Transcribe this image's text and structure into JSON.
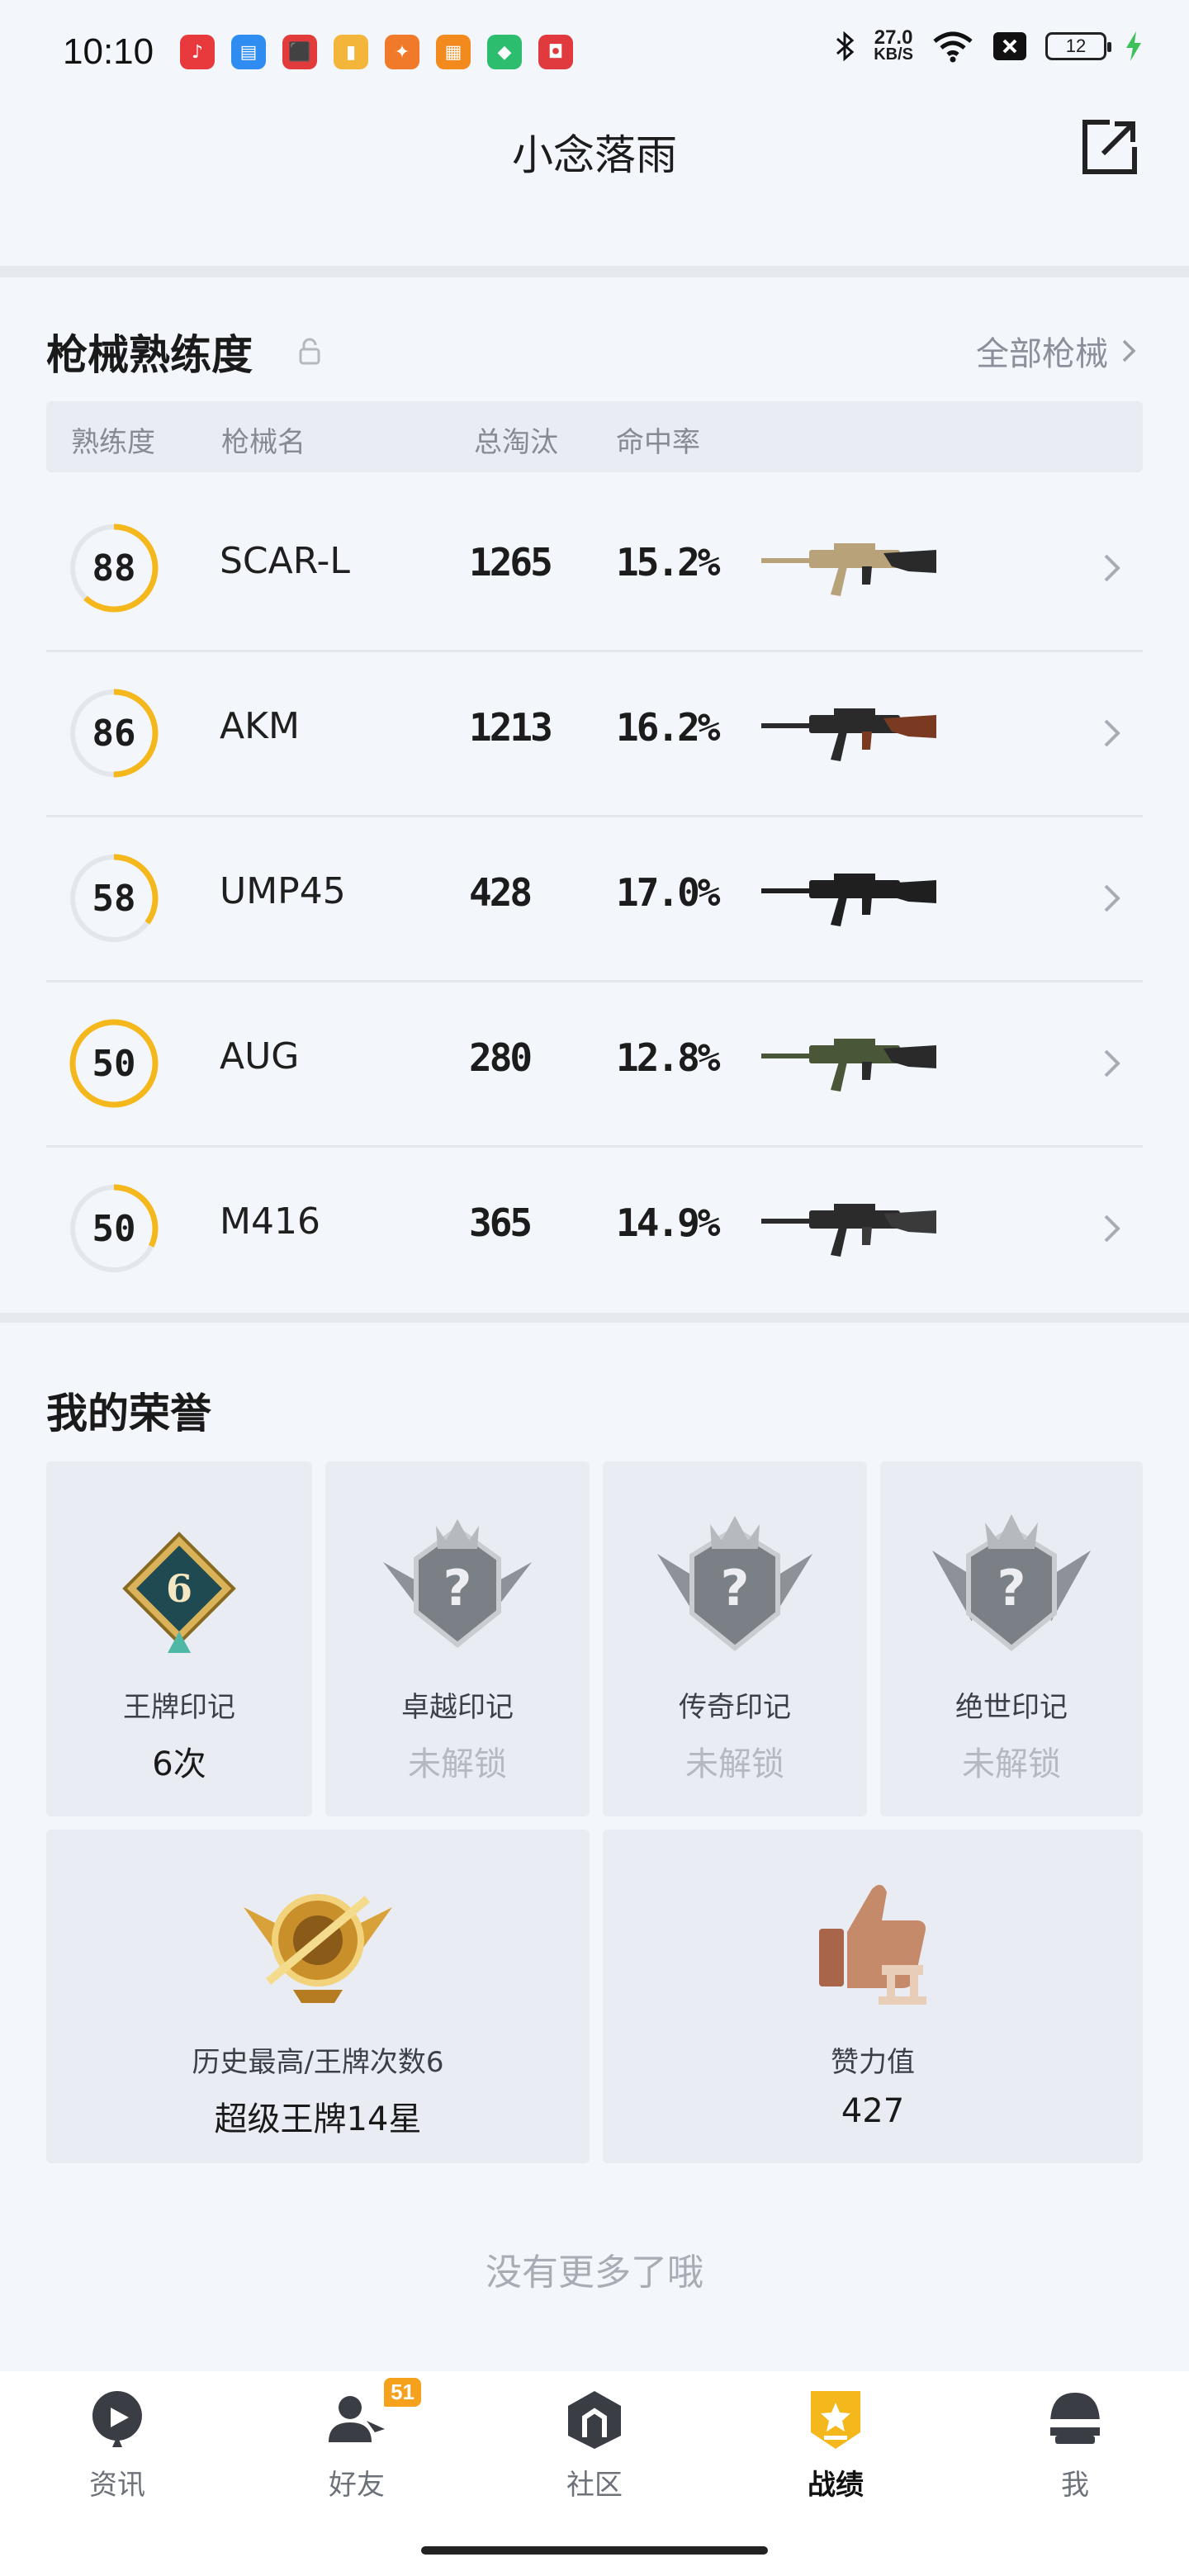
{
  "status_bar": {
    "time": "10:10",
    "net_speed_value": "27.0",
    "net_speed_unit": "KB/S",
    "battery": "12",
    "apps": [
      {
        "icon": "music-app-icon",
        "color": "#e8393d",
        "glyph": "♪"
      },
      {
        "icon": "files-app-icon",
        "color": "#2f8cf0",
        "glyph": "▤"
      },
      {
        "icon": "shop-app-icon",
        "color": "#e23b3b",
        "glyph": "⬛"
      },
      {
        "icon": "notes-app-icon",
        "color": "#f3b53a",
        "glyph": "▮"
      },
      {
        "icon": "game-app-icon",
        "color": "#f07a2a",
        "glyph": "✦"
      },
      {
        "icon": "video-app-icon",
        "color": "#f28a1e",
        "glyph": "▦"
      },
      {
        "icon": "security-app-icon",
        "color": "#2dbd6e",
        "glyph": "◆"
      },
      {
        "icon": "store-app-icon",
        "color": "#e03a3e",
        "glyph": "◘"
      }
    ]
  },
  "header": {
    "title": "小念落雨"
  },
  "weapons": {
    "title": "枪械熟练度",
    "all_link": "全部枪械",
    "columns": [
      "熟练度",
      "枪械名",
      "总淘汰",
      "命中率"
    ],
    "rows": [
      {
        "proficiency": "88",
        "progress": 0.62,
        "name": "SCAR-L",
        "kills": "1265",
        "accuracy": "15.2%",
        "gun_icon": "scar-l-rifle-image"
      },
      {
        "proficiency": "86",
        "progress": 0.5,
        "name": "AKM",
        "kills": "1213",
        "accuracy": "16.2%",
        "gun_icon": "akm-rifle-image"
      },
      {
        "proficiency": "58",
        "progress": 0.35,
        "name": "UMP45",
        "kills": "428",
        "accuracy": "17.0%",
        "gun_icon": "ump45-smg-image"
      },
      {
        "proficiency": "50",
        "progress": 1.0,
        "name": "AUG",
        "kills": "280",
        "accuracy": "12.8%",
        "gun_icon": "aug-rifle-image"
      },
      {
        "proficiency": "50",
        "progress": 0.32,
        "name": "M416",
        "kills": "365",
        "accuracy": "14.9%",
        "gun_icon": "m416-rifle-image"
      }
    ]
  },
  "honors": {
    "title": "我的荣誉",
    "marks": [
      {
        "label": "王牌印记",
        "value": "6次",
        "locked": false,
        "badge_number": "6"
      },
      {
        "label": "卓越印记",
        "value": "未解锁",
        "locked": true
      },
      {
        "label": "传奇印记",
        "value": "未解锁",
        "locked": true
      },
      {
        "label": "绝世印记",
        "value": "未解锁",
        "locked": true
      }
    ],
    "rank": {
      "label": "历史最高/王牌次数6",
      "value": "超级王牌14星"
    },
    "likes": {
      "label": "赞力值",
      "value": "427"
    }
  },
  "footer_text": "没有更多了哦",
  "bottom_nav": {
    "items": [
      {
        "label": "资讯",
        "icon": "news-icon",
        "active": false
      },
      {
        "label": "好友",
        "icon": "friends-icon",
        "active": false,
        "badge": "51"
      },
      {
        "label": "社区",
        "icon": "community-icon",
        "active": false
      },
      {
        "label": "战绩",
        "icon": "record-icon",
        "active": true
      },
      {
        "label": "我",
        "icon": "profile-helmet-icon",
        "active": false
      }
    ]
  },
  "colors": {
    "accent": "#f5b81c",
    "background": "#f3f6fb"
  }
}
